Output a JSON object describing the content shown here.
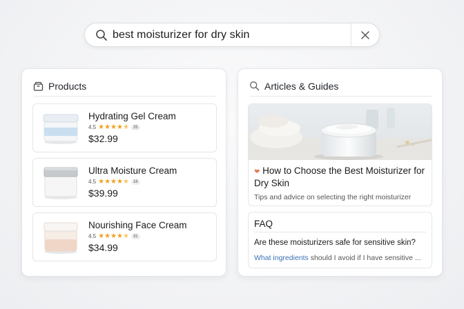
{
  "search": {
    "query": "best moisturizer for dry skin",
    "icon": "search-icon",
    "clear_icon": "close-icon"
  },
  "products_panel": {
    "title": "Products",
    "icon": "box-icon",
    "items": [
      {
        "name": "Hydrating Gel Cream",
        "rating": "4.5",
        "review_count": "25",
        "price": "$32.99",
        "lid_color": "#d6e8f3"
      },
      {
        "name": "Ultra Moisture Cream",
        "rating": "4.5",
        "review_count": "16",
        "price": "$39.99",
        "lid_color": "#b9bcc0"
      },
      {
        "name": "Nourishing Face Cream",
        "rating": "4.5",
        "review_count": "31",
        "price": "$34.99",
        "lid_color": "#ead3c6"
      }
    ]
  },
  "articles_panel": {
    "title": "Articles & Guides",
    "icon": "search-icon",
    "article": {
      "title": "How to Choose the Best Moisturizer for Dry Skin",
      "description": "Tips and advice on selecting the right moisturizer"
    },
    "faq": {
      "title": "FAQ",
      "question_1": "Are these moisturizers safe for sensitive skin?",
      "question_2_link": "What ingredients",
      "question_2_rest": " should I avoid if I have sensitive ..."
    }
  },
  "colors": {
    "star": "#f0a020",
    "link": "#3b6fb5"
  }
}
